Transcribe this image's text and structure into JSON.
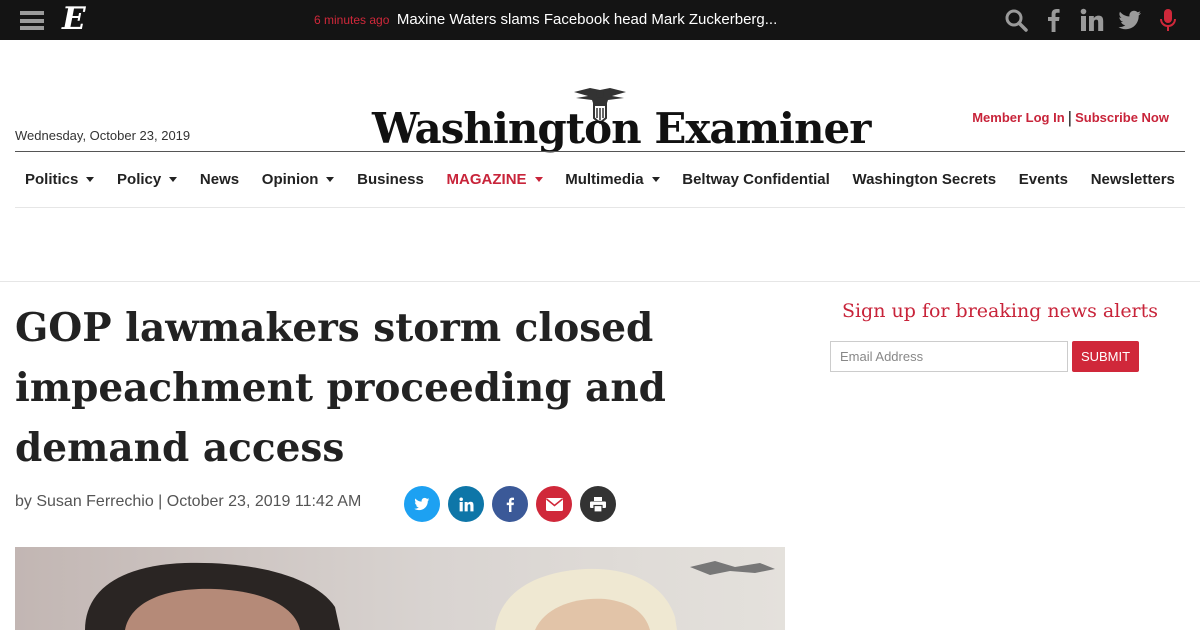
{
  "topbar": {
    "logo": "E",
    "ticker_time": "6 minutes ago",
    "ticker_headline": "Maxine Waters slams Facebook head Mark Zuckerberg...",
    "icons": [
      "search-icon",
      "facebook-icon",
      "linkedin-icon",
      "twitter-icon",
      "microphone-icon"
    ]
  },
  "masthead": {
    "date": "Wednesday, October 23, 2019",
    "brand": "Washington Examiner",
    "member_login": "Member Log In",
    "separator": "|",
    "subscribe": "Subscribe Now"
  },
  "nav": {
    "items": [
      {
        "label": "Politics",
        "dropdown": true
      },
      {
        "label": "Policy",
        "dropdown": true
      },
      {
        "label": "News",
        "dropdown": false
      },
      {
        "label": "Opinion",
        "dropdown": true
      },
      {
        "label": "Business",
        "dropdown": false
      },
      {
        "label": "MAGAZINE",
        "dropdown": true,
        "highlight": true
      },
      {
        "label": "Multimedia",
        "dropdown": true
      },
      {
        "label": "Beltway Confidential",
        "dropdown": false
      },
      {
        "label": "Washington Secrets",
        "dropdown": false
      },
      {
        "label": "Events",
        "dropdown": false
      },
      {
        "label": "Newsletters",
        "dropdown": false
      }
    ]
  },
  "article": {
    "title": "GOP lawmakers storm closed impeachment proceeding and demand access",
    "byline": "by Susan Ferrechio | October 23, 2019 11:42 AM",
    "share_buttons": [
      {
        "icon": "twitter-icon",
        "color": "#1da1f2"
      },
      {
        "icon": "linkedin-icon",
        "color": "#0e76a8"
      },
      {
        "icon": "facebook-icon",
        "color": "#3b5998"
      },
      {
        "icon": "email-icon",
        "color": "#d0283a"
      },
      {
        "icon": "print-icon",
        "color": "#333333"
      }
    ]
  },
  "sidebar": {
    "signup_title": "Sign up for breaking news alerts",
    "email_placeholder": "Email Address",
    "submit_label": "SUBMIT"
  },
  "colors": {
    "accent": "#c8243a",
    "topbar_bg": "#141414"
  }
}
